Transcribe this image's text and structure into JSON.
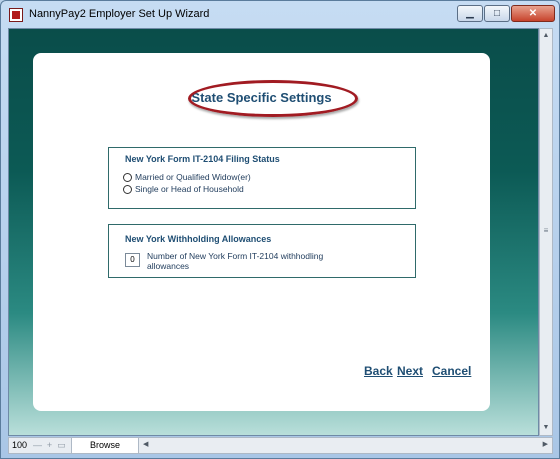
{
  "window": {
    "title": "NannyPay2 Employer Set Up Wizard",
    "minimize_glyph": "▁",
    "maximize_glyph": "□",
    "close_glyph": "✕"
  },
  "main": {
    "heading": "State Specific Settings",
    "filing_status": {
      "title": "New York Form IT-2104 Filing Status",
      "options": [
        "Married or Qualified Widow(er)",
        "Single or Head of Household"
      ]
    },
    "allowances": {
      "title": "New York Withholding Allowances",
      "value": "0",
      "label": "Number of New York Form IT-2104 withhodling allowances"
    },
    "nav": {
      "back": "Back",
      "next": "Next",
      "cancel": "Cancel"
    }
  },
  "statusbar": {
    "zoom": "100",
    "mode": "Browse"
  },
  "colors": {
    "accent": "#1f4e73",
    "highlight_ellipse": "#a11b22",
    "background_top": "#0a4d4a"
  }
}
